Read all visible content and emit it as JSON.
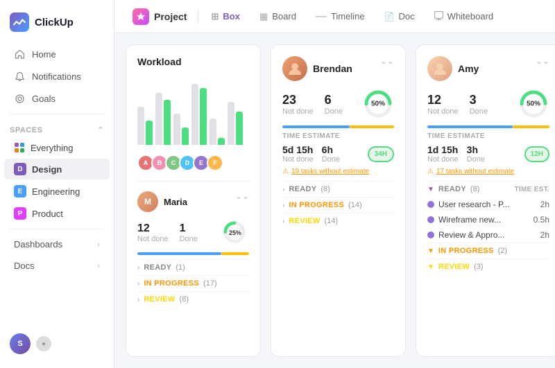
{
  "sidebar": {
    "logo": "ClickUp",
    "nav": [
      {
        "label": "Home",
        "icon": "🏠"
      },
      {
        "label": "Notifications",
        "icon": "🔔"
      },
      {
        "label": "Goals",
        "icon": "🎯"
      }
    ],
    "spaces_label": "Spaces",
    "spaces": [
      {
        "label": "Everything",
        "color": "purple",
        "letter": "✦"
      },
      {
        "label": "Design",
        "color": "purple",
        "letter": "D"
      },
      {
        "label": "Engineering",
        "color": "blue",
        "letter": "E"
      },
      {
        "label": "Product",
        "color": "pink",
        "letter": "P"
      }
    ],
    "bottom_nav": [
      {
        "label": "Dashboards"
      },
      {
        "label": "Docs"
      }
    ],
    "bottom_avatars": [
      "S"
    ]
  },
  "topbar": {
    "project_label": "Project",
    "tabs": [
      {
        "label": "Box",
        "icon": "⊞",
        "active": true
      },
      {
        "label": "Board",
        "icon": "▦"
      },
      {
        "label": "Timeline",
        "icon": "—"
      },
      {
        "label": "Doc",
        "icon": "📄"
      },
      {
        "label": "Whiteboard",
        "icon": "⬜"
      }
    ]
  },
  "workload": {
    "title": "Workload",
    "bars": [
      {
        "gray": 60,
        "green": 40
      },
      {
        "gray": 80,
        "green": 70
      },
      {
        "gray": 50,
        "green": 30
      },
      {
        "gray": 90,
        "green": 85
      },
      {
        "gray": 40,
        "green": 10
      },
      {
        "gray": 65,
        "green": 50
      }
    ],
    "avatars": [
      {
        "bg": "#e57373",
        "letter": "A"
      },
      {
        "bg": "#f48fb1",
        "letter": "B"
      },
      {
        "bg": "#81c784",
        "letter": "C"
      },
      {
        "bg": "#4fc3f7",
        "letter": "D"
      },
      {
        "bg": "#9575cd",
        "letter": "E"
      },
      {
        "bg": "#ffb74d",
        "letter": "F"
      }
    ]
  },
  "brendan": {
    "name": "Brendan",
    "not_done": 23,
    "done": 6,
    "not_done_label": "Not done",
    "done_label": "Done",
    "percent": 50,
    "progress_blue": 60,
    "progress_yellow": 40,
    "time_estimate_label": "TIME ESTIMATE",
    "time_not_done_val": "5d 15h",
    "time_done_val": "6h",
    "time_not_done_label": "Not done",
    "time_done_label": "Done",
    "time_badge": "34H",
    "warning": "19 tasks without estimate",
    "sections": [
      {
        "type": "ready",
        "label": "READY",
        "count": "(8)"
      },
      {
        "type": "inprogress",
        "label": "IN PROGRESS",
        "count": "(14)"
      },
      {
        "type": "review",
        "label": "REVIEW",
        "count": "(14)"
      }
    ]
  },
  "amy": {
    "name": "Amy",
    "not_done": 12,
    "done": 3,
    "not_done_label": "Not done",
    "done_label": "Done",
    "percent": 50,
    "progress_blue": 70,
    "progress_yellow": 30,
    "time_estimate_label": "TIME ESTIMATE",
    "time_not_done_val": "1d 15h",
    "time_done_val": "3h",
    "time_not_done_label": "Not done",
    "time_done_label": "Done",
    "time_badge": "12H",
    "warning": "17 tasks without estimate",
    "ready_label": "READY",
    "ready_count": "(8)",
    "time_est_header": "TIME EST.",
    "tasks": [
      {
        "name": "User research - P...",
        "time": "2h"
      },
      {
        "name": "Wireframe new...",
        "time": "0.5h"
      },
      {
        "name": "Review & Appro...",
        "time": "2h"
      }
    ],
    "inprogress_label": "IN PROGRESS",
    "inprogress_count": "(2)",
    "review_label": "REVIEW",
    "review_count": "(3)"
  },
  "maria": {
    "name": "Maria",
    "not_done": 12,
    "done": 1,
    "not_done_label": "Not done",
    "done_label": "Done",
    "percent": 25,
    "progress_blue": 80,
    "progress_yellow": 20,
    "sections": [
      {
        "type": "ready",
        "label": "READY",
        "count": "(1)"
      },
      {
        "type": "inprogress",
        "label": "IN PROGRESS",
        "count": "(17)"
      },
      {
        "type": "review",
        "label": "REVIEW",
        "count": "(8)"
      }
    ]
  }
}
